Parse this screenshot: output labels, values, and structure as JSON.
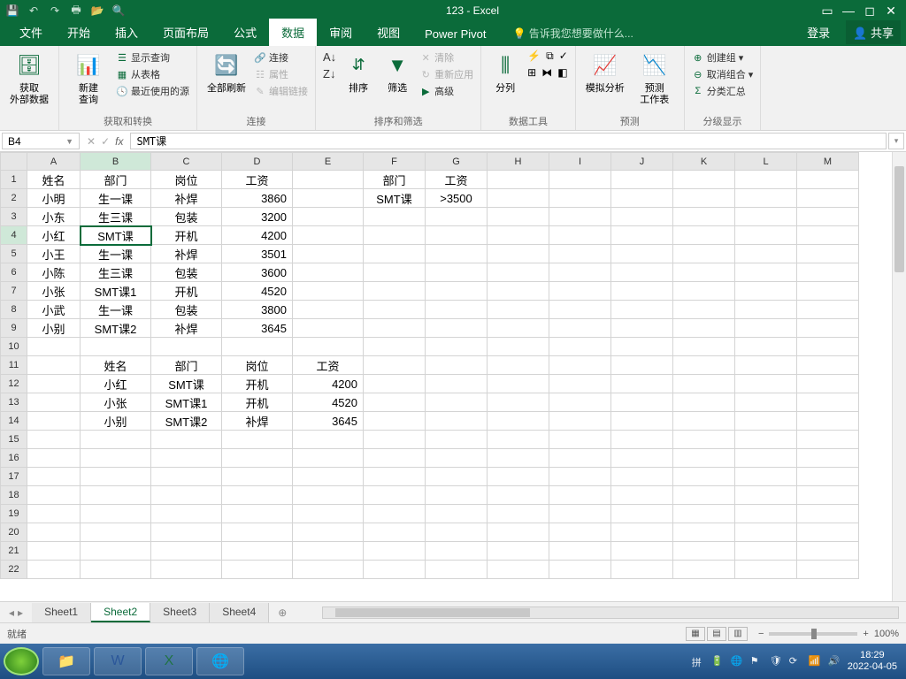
{
  "title": "123 - Excel",
  "tabs": {
    "file": "文件",
    "home": "开始",
    "insert": "插入",
    "layout": "页面布局",
    "formula": "公式",
    "data": "数据",
    "review": "审阅",
    "view": "视图",
    "pivot": "Power Pivot"
  },
  "tell": "告诉我您想要做什么...",
  "login": "登录",
  "share": "共享",
  "ribbon": {
    "g1": {
      "btn": "获取\n外部数据",
      "label": ""
    },
    "g2": {
      "btn": "新建\n查询",
      "i1": "显示查询",
      "i2": "从表格",
      "i3": "最近使用的源",
      "label": "获取和转换"
    },
    "g3": {
      "btn": "全部刷新",
      "i1": "连接",
      "i2": "属性",
      "i3": "编辑链接",
      "label": "连接"
    },
    "g4": {
      "btn": "排序",
      "btn2": "筛选",
      "i1": "清除",
      "i2": "重新应用",
      "i3": "高级",
      "label": "排序和筛选"
    },
    "g5": {
      "btn": "分列",
      "label": "数据工具"
    },
    "g6": {
      "btn": "模拟分析",
      "btn2": "预测\n工作表",
      "label": "预测"
    },
    "g7": {
      "i1": "创建组",
      "i2": "取消组合",
      "i3": "分类汇总",
      "label": "分级显示"
    }
  },
  "namebox": "B4",
  "formula": "SMT课",
  "cols": [
    "A",
    "B",
    "C",
    "D",
    "E",
    "F",
    "G",
    "H",
    "I",
    "J",
    "K",
    "L",
    "M"
  ],
  "rows": [
    "1",
    "2",
    "3",
    "4",
    "5",
    "6",
    "7",
    "8",
    "9",
    "10",
    "11",
    "12",
    "13",
    "14",
    "15",
    "16",
    "17",
    "18",
    "19",
    "20",
    "21",
    "22"
  ],
  "cells": {
    "r1": {
      "A": "姓名",
      "B": "部门",
      "C": "岗位",
      "D": "工资",
      "F": "部门",
      "G": "工资"
    },
    "r2": {
      "A": "小明",
      "B": "生一课",
      "C": "补焊",
      "D": "3860",
      "F": "SMT课",
      "G": ">3500"
    },
    "r3": {
      "A": "小东",
      "B": "生三课",
      "C": "包装",
      "D": "3200"
    },
    "r4": {
      "A": "小红",
      "B": "SMT课",
      "C": "开机",
      "D": "4200"
    },
    "r5": {
      "A": "小王",
      "B": "生一课",
      "C": "补焊",
      "D": "3501"
    },
    "r6": {
      "A": "小陈",
      "B": "生三课",
      "C": "包装",
      "D": "3600"
    },
    "r7": {
      "A": "小张",
      "B": "SMT课1",
      "C": "开机",
      "D": "4520"
    },
    "r8": {
      "A": "小武",
      "B": "生一课",
      "C": "包装",
      "D": "3800"
    },
    "r9": {
      "A": "小别",
      "B": "SMT课2",
      "C": "补焊",
      "D": "3645"
    },
    "r11": {
      "B": "姓名",
      "C": "部门",
      "D": "岗位",
      "E": "工资"
    },
    "r12": {
      "B": "小红",
      "C": "SMT课",
      "D": "开机",
      "E": "4200"
    },
    "r13": {
      "B": "小张",
      "C": "SMT课1",
      "D": "开机",
      "E": "4520"
    },
    "r14": {
      "B": "小别",
      "C": "SMT课2",
      "D": "补焊",
      "E": "3645"
    }
  },
  "sheets": [
    "Sheet1",
    "Sheet2",
    "Sheet3",
    "Sheet4"
  ],
  "activeSheet": 1,
  "status": "就绪",
  "zoom": "100%",
  "clock": {
    "time": "18:29",
    "date": "2022-04-05"
  }
}
